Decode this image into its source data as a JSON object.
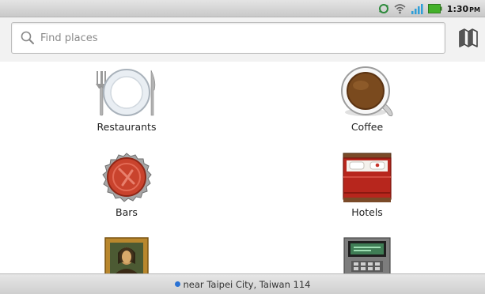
{
  "status_bar": {
    "time": "1:30",
    "time_suffix": "PM",
    "icons": [
      "sync-icon",
      "wifi-icon",
      "signal-icon",
      "battery-icon"
    ],
    "colors": {
      "signal": "#2f9fd8",
      "battery": "#43b02a"
    }
  },
  "search": {
    "placeholder": "Find places",
    "value": "",
    "icon": "search-icon",
    "map_button_icon": "map-icon"
  },
  "categories": [
    {
      "label": "Restaurants",
      "icon": "plate-icon"
    },
    {
      "label": "Coffee",
      "icon": "coffee-icon"
    },
    {
      "label": "Bars",
      "icon": "bottle-cap-icon"
    },
    {
      "label": "Hotels",
      "icon": "bed-icon"
    },
    {
      "label": "",
      "icon": "museum-painting-icon"
    },
    {
      "label": "",
      "icon": "atm-icon"
    }
  ],
  "location": {
    "text": "near Taipei City, Taiwan 114",
    "dot_color": "#2a72d4"
  }
}
